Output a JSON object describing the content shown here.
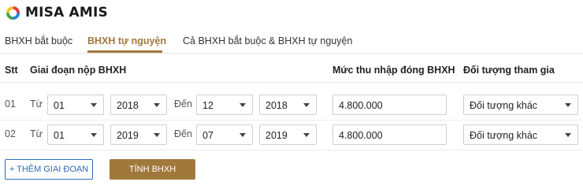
{
  "brand": {
    "name": "MISA AMIS"
  },
  "tabs": [
    {
      "label": "BHXH bắt buộc"
    },
    {
      "label": "BHXH tự nguyện"
    },
    {
      "label": "Cả BHXH bắt buộc & BHXH tự nguyện"
    }
  ],
  "table": {
    "headers": {
      "stt": "Stt",
      "period": "Giai đoạn nộp BHXH",
      "income": "Mức thu nhập đóng BHXH",
      "participant": "Đối tượng tham gia"
    },
    "rows": [
      {
        "stt": "01",
        "from_label": "Từ",
        "from_month": "01",
        "from_year": "2018",
        "to_label": "Đến",
        "to_month": "12",
        "to_year": "2018",
        "income": "4.800.000",
        "participant": "Đối tượng khác"
      },
      {
        "stt": "02",
        "from_label": "Từ",
        "from_month": "01",
        "from_year": "2019",
        "to_label": "Đến",
        "to_month": "07",
        "to_year": "2019",
        "income": "4.800.000",
        "participant": "Đối tượng khác"
      }
    ]
  },
  "actions": {
    "add_period": "+ THÊM GIAI ĐOẠN",
    "calculate": "TÍNH BHXH"
  },
  "colors": {
    "accent": "#a0783c",
    "link_blue": "#2e6bb8",
    "logo_ring": [
      "#e53935",
      "#fbc02d",
      "#43a047",
      "#1e88e5"
    ]
  }
}
